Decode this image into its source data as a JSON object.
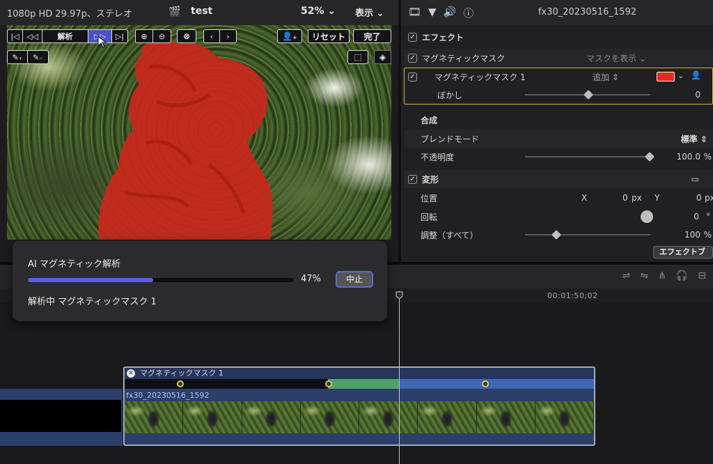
{
  "viewer": {
    "format": "1080p HD 29.97p、ステレオ",
    "project_title": "test",
    "zoom": "52%",
    "view_menu": "表示",
    "controls": {
      "analyze_label": "解析",
      "reset_label": "リセット",
      "done_label": "完了"
    }
  },
  "inspector": {
    "clip_name": "fx30_20230516_1592",
    "effects_header": "エフェクト",
    "magnetic_mask": "マグネティックマスク",
    "show_mask": "マスクを表示",
    "mask_item": "マグネティックマスク 1",
    "add_mode": "追加",
    "blur_label": "ぼかし",
    "blur_value": "0",
    "compositing": "合成",
    "blend_mode_label": "ブレンドモード",
    "blend_mode_value": "標準",
    "opacity_label": "不透明度",
    "opacity_value": "100.0",
    "opacity_unit": "%",
    "transform": "変形",
    "position_label": "位置",
    "pos_x_label": "X",
    "pos_x_value": "0",
    "pos_x_unit": "px",
    "pos_y_label": "Y",
    "pos_y_value": "0",
    "pos_y_unit": "px",
    "rotation_label": "回転",
    "rotation_value": "0",
    "rotation_unit": "°",
    "scale_label": "調整（すべて）",
    "scale_value": "100",
    "scale_unit": "%",
    "effects_browser_button": "エフェクトブ",
    "mask_color": "#e22b1f"
  },
  "timeline": {
    "timecode": "00:01:50;02",
    "clip_title": "マグネティックマスク 1",
    "clip_name": "fx30_20230516_1592"
  },
  "hud": {
    "title": "AI マグネティック解析",
    "progress_percent": 47,
    "progress_text": "47%",
    "stop_label": "中止",
    "status": "解析中 マグネティックマスク 1"
  }
}
